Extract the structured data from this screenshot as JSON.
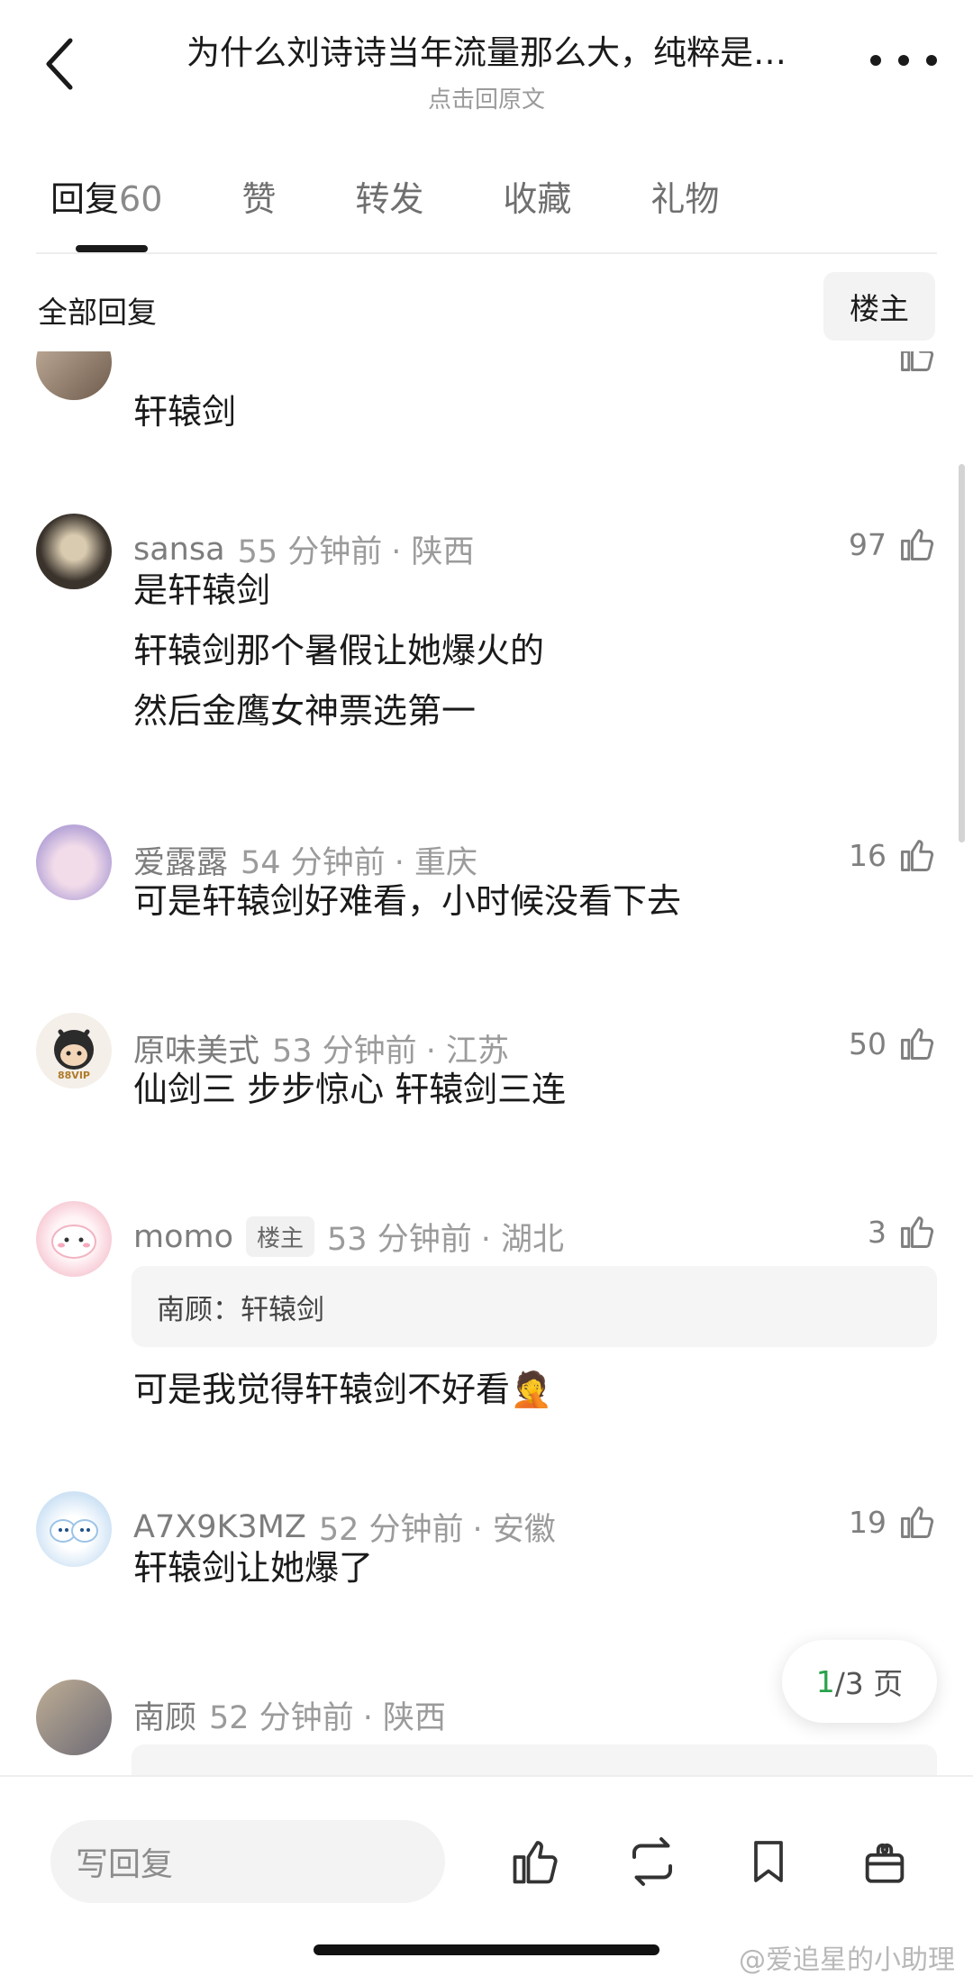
{
  "header": {
    "title": "为什么刘诗诗当年流量那么大，纯粹是…",
    "subtitle": "点击回原文"
  },
  "tabs": [
    {
      "label": "回复",
      "count": "60"
    },
    {
      "label": "赞"
    },
    {
      "label": "转发"
    },
    {
      "label": "收藏"
    },
    {
      "label": "礼物"
    }
  ],
  "filter": {
    "label": "全部回复",
    "op_button": "楼主"
  },
  "comments": [
    {
      "text": "轩辕剑"
    },
    {
      "name": "sansa",
      "time": "55 分钟前",
      "location": "· 陕西",
      "likes": "97",
      "lines": [
        "是轩辕剑",
        "轩辕剑那个暑假让她爆火的",
        "然后金鹰女神票选第一"
      ]
    },
    {
      "name": "爱露露",
      "time": "54 分钟前",
      "location": "· 重庆",
      "likes": "16",
      "lines": [
        "可是轩辕剑好难看，小时候没看下去"
      ]
    },
    {
      "name": "原味美式",
      "time": "53 分钟前",
      "location": "· 江苏",
      "likes": "50",
      "lines": [
        "仙剑三 步步惊心 轩辕剑三连"
      ],
      "avatar_badge": "88VIP"
    },
    {
      "name": "momo",
      "badge": "楼主",
      "time": "53 分钟前",
      "location": "· 湖北",
      "likes": "3",
      "quote": "南顾：轩辕剑",
      "lines": [
        "可是我觉得轩辕剑不好看"
      ],
      "emoji": "🤦"
    },
    {
      "name": "A7X9K3MZ",
      "time": "52 分钟前",
      "location": "· 安徽",
      "likes": "19",
      "lines": [
        "轩辕剑让她爆了"
      ]
    },
    {
      "name": "南顾",
      "time": "52 分钟前",
      "location": "· 陕西"
    }
  ],
  "page_indicator": {
    "current": "1",
    "total": "/3 页"
  },
  "bottom_bar": {
    "reply_placeholder": "写回复"
  },
  "watermark": "@爱追星的小助理",
  "icons": [
    "back-arrow-icon",
    "more-icon",
    "thumbs-up-icon",
    "repost-icon",
    "bookmark-icon",
    "gift-icon"
  ]
}
